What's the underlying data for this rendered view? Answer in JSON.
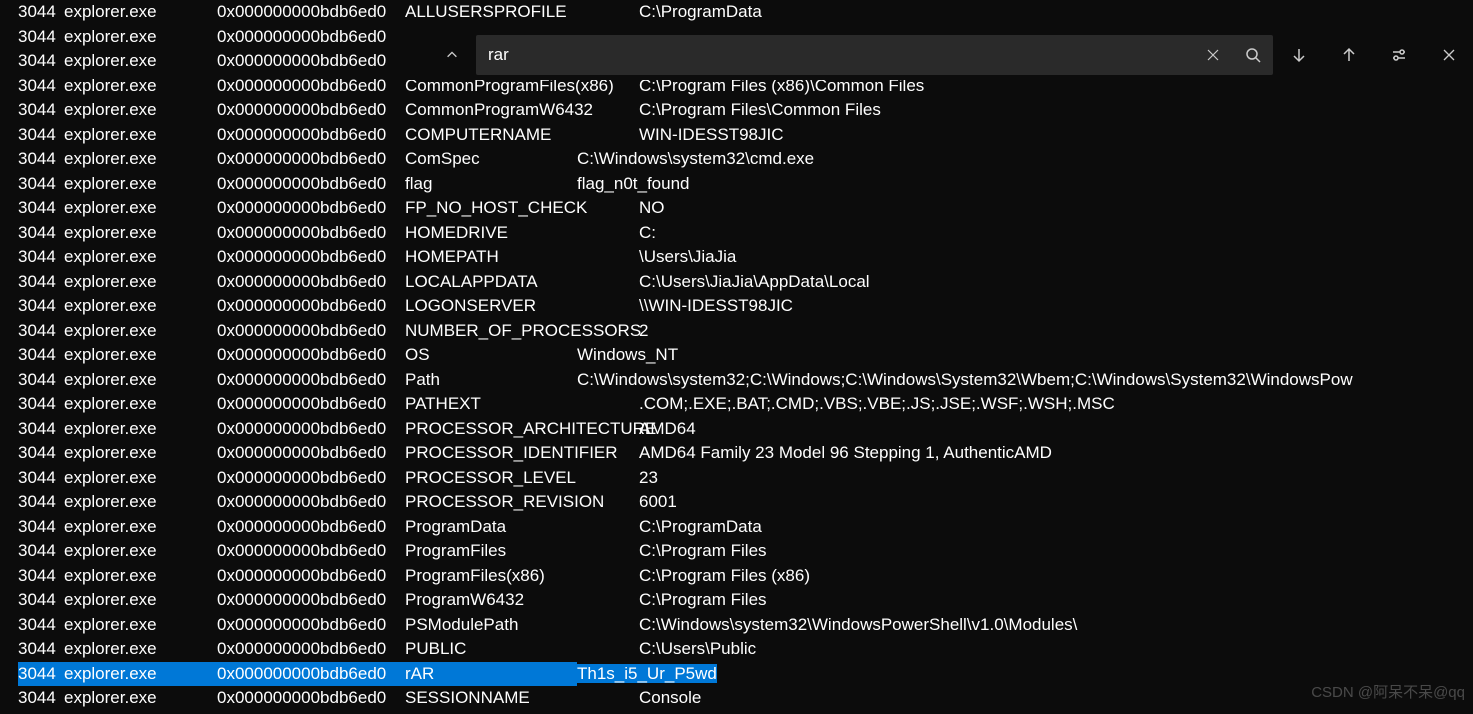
{
  "find": {
    "value": "rar",
    "placeholder": ""
  },
  "watermark": "CSDN @阿呆不呆@qq",
  "common": {
    "pid": "3044",
    "proc": "explorer.exe",
    "addr": "0x000000000bdb6ed0"
  },
  "rows": [
    {
      "var": "ALLUSERSPROFILE",
      "val": "C:\\ProgramData"
    },
    {
      "var": "",
      "val": ""
    },
    {
      "var": "",
      "val": ""
    },
    {
      "var": "CommonProgramFiles(x86)",
      "val": "C:\\Program Files (x86)\\Common Files"
    },
    {
      "var": "CommonProgramW6432",
      "val": "C:\\Program Files\\Common Files"
    },
    {
      "var": "COMPUTERNAME",
      "val": "WIN-IDESST98JIC"
    },
    {
      "var": "ComSpec",
      "val": "C:\\Windows\\system32\\cmd.exe",
      "short": true
    },
    {
      "var": "flag",
      "val": "flag_n0t_found",
      "short": true
    },
    {
      "var": "FP_NO_HOST_CHECK",
      "val": "NO"
    },
    {
      "var": "HOMEDRIVE",
      "val": "C:"
    },
    {
      "var": "HOMEPATH",
      "val": "\\Users\\JiaJia"
    },
    {
      "var": "LOCALAPPDATA",
      "val": "C:\\Users\\JiaJia\\AppData\\Local"
    },
    {
      "var": "LOGONSERVER",
      "val": "\\\\WIN-IDESST98JIC"
    },
    {
      "var": "NUMBER_OF_PROCESSORS",
      "val": "2"
    },
    {
      "var": "OS",
      "val": "Windows_NT",
      "short": true
    },
    {
      "var": "Path",
      "val": "C:\\Windows\\system32;C:\\Windows;C:\\Windows\\System32\\Wbem;C:\\Windows\\System32\\WindowsPow",
      "short": true
    },
    {
      "var": "PATHEXT",
      "val": ".COM;.EXE;.BAT;.CMD;.VBS;.VBE;.JS;.JSE;.WSF;.WSH;.MSC"
    },
    {
      "var": "PROCESSOR_ARCHITECTURE",
      "val": "AMD64"
    },
    {
      "var": "PROCESSOR_IDENTIFIER",
      "val": "AMD64 Family 23 Model 96 Stepping 1, AuthenticAMD"
    },
    {
      "var": "PROCESSOR_LEVEL",
      "val": "23"
    },
    {
      "var": "PROCESSOR_REVISION",
      "val": "6001"
    },
    {
      "var": "ProgramData",
      "val": "C:\\ProgramData"
    },
    {
      "var": "ProgramFiles",
      "val": "C:\\Program Files"
    },
    {
      "var": "ProgramFiles(x86)",
      "val": "C:\\Program Files (x86)"
    },
    {
      "var": "ProgramW6432",
      "val": "C:\\Program Files"
    },
    {
      "var": "PSModulePath",
      "val": "C:\\Windows\\system32\\WindowsPowerShell\\v1.0\\Modules\\"
    },
    {
      "var": "PUBLIC",
      "val": "C:\\Users\\Public"
    },
    {
      "var": "rAR",
      "val": "Th1s_i5_Ur_P5wd",
      "highlight": true,
      "short": true
    },
    {
      "var": "SESSIONNAME",
      "val": "Console"
    }
  ]
}
